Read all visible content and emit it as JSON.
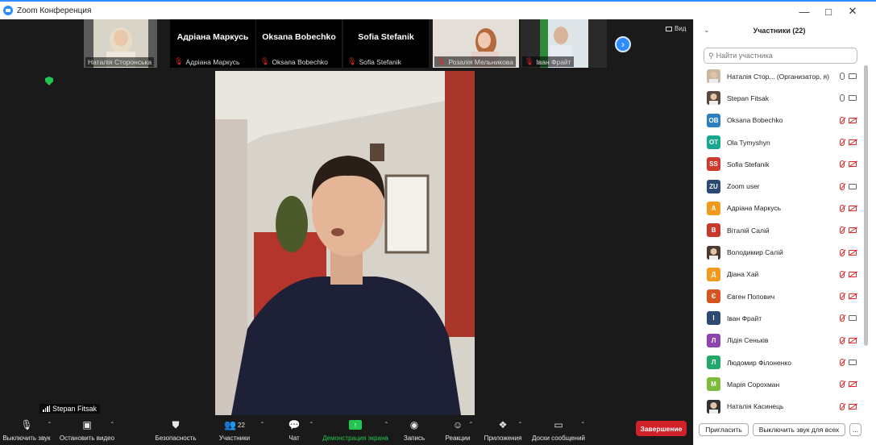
{
  "window": {
    "title": "Zoom Конференция",
    "controls": [
      "minimize",
      "maximize",
      "close"
    ]
  },
  "thumbnails": [
    {
      "caption": "Наталія Сторонська",
      "name": "",
      "muted": false,
      "has_video": true
    },
    {
      "caption": "Адріана Маркусь",
      "name": "Адріана Маркусь",
      "muted": true,
      "has_video": false
    },
    {
      "caption": "Oksana Bobechko",
      "name": "Oksana Bobechko",
      "muted": true,
      "has_video": false
    },
    {
      "caption": "Sofia Stefanik",
      "name": "Sofia Stefanik",
      "muted": true,
      "has_video": false
    },
    {
      "caption": "Розалія Мельникова",
      "name": "",
      "muted": true,
      "has_video": true
    },
    {
      "caption": "Іван Фрайт",
      "name": "",
      "muted": true,
      "has_video": true
    }
  ],
  "view_button": "Вид",
  "active_speaker": "Stepan Fitsak",
  "toolbar": {
    "mute": "Выключить звук",
    "stop_video": "Остановить видео",
    "security": "Безопасность",
    "participants": "Участники",
    "participants_count": "22",
    "chat": "Чат",
    "share_screen": "Демонстрация экрана",
    "record": "Запись",
    "reactions": "Реакции",
    "apps": "Приложения",
    "whiteboards": "Доски сообщений",
    "end": "Завершение"
  },
  "panel": {
    "title": "Участники (22)",
    "search_placeholder": "Найти участника",
    "invite": "Пригласить",
    "mute_all": "Выключить звук для всех",
    "more": "..."
  },
  "participants": [
    {
      "name": "Наталія Стор... (Организатор, я)",
      "avatar": "",
      "color": "#c8b8a0",
      "mic_on": true,
      "cam_on": true,
      "photo": true
    },
    {
      "name": "Stepan Fitsak",
      "avatar": "",
      "color": "#5a4a40",
      "mic_on": true,
      "mic_active": true,
      "cam_on": true,
      "photo": true
    },
    {
      "name": "Oksana Bobechko",
      "avatar": "OB",
      "color": "#2d7fc1",
      "mic_on": false,
      "cam_on": false
    },
    {
      "name": "Ola Tymyshyn",
      "avatar": "OT",
      "color": "#19a88f",
      "mic_on": false,
      "cam_on": false
    },
    {
      "name": "Sofia Stefanik",
      "avatar": "SS",
      "color": "#cc3b2e",
      "mic_on": false,
      "cam_on": false
    },
    {
      "name": "Zoom user",
      "avatar": "ZU",
      "color": "#2c4a72",
      "mic_on": false,
      "cam_on": true
    },
    {
      "name": "Адріана Маркусь",
      "avatar": "А",
      "color": "#f39a1c",
      "mic_on": false,
      "cam_on": false
    },
    {
      "name": "Віталій Салій",
      "avatar": "В",
      "color": "#c63a2b",
      "mic_on": false,
      "cam_on": false
    },
    {
      "name": "Володимир Салій",
      "avatar": "",
      "color": "#4a3a30",
      "mic_on": false,
      "cam_on": false,
      "photo": true
    },
    {
      "name": "Діана Хай",
      "avatar": "Д",
      "color": "#f39a1c",
      "mic_on": false,
      "cam_on": false
    },
    {
      "name": "Євген Попович",
      "avatar": "Є",
      "color": "#d8541e",
      "mic_on": false,
      "cam_on": false
    },
    {
      "name": "Іван Фрайт",
      "avatar": "І",
      "color": "#2c4a72",
      "mic_on": false,
      "cam_on": true
    },
    {
      "name": "Лідія Сеньків",
      "avatar": "Л",
      "color": "#8e44ad",
      "mic_on": false,
      "cam_on": false
    },
    {
      "name": "Людомир Філоненко",
      "avatar": "Л",
      "color": "#22a86a",
      "mic_on": false,
      "cam_on": true
    },
    {
      "name": "Марія Сорохман",
      "avatar": "М",
      "color": "#7dbb3c",
      "mic_on": false,
      "cam_on": false
    },
    {
      "name": "Наталія Касинець",
      "avatar": "",
      "color": "#333",
      "mic_on": false,
      "cam_on": false,
      "photo": true
    }
  ]
}
